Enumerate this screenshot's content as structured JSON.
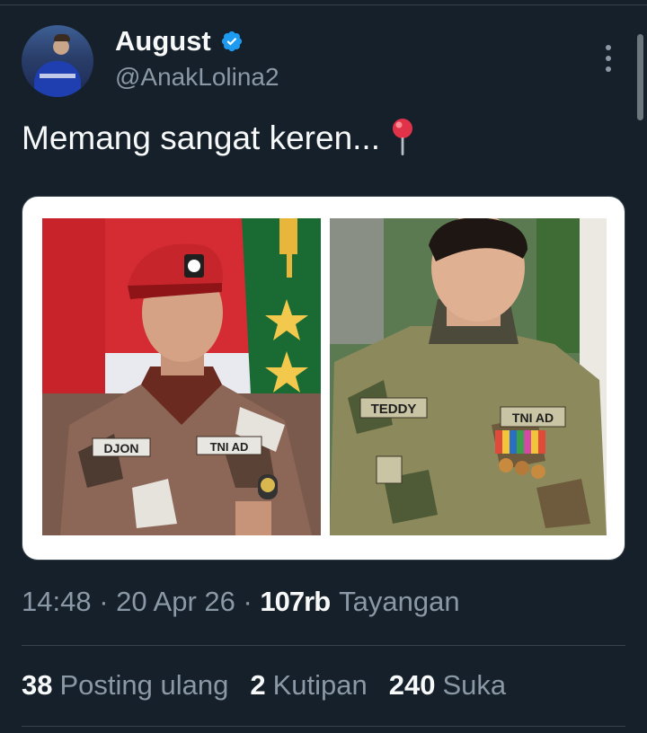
{
  "user": {
    "display_name": "August",
    "handle": "@AnakLolina2",
    "verified_icon": "verified-badge-icon"
  },
  "tweet": {
    "text": "Memang sangat keren...",
    "emoji_icon": "round-pushpin-icon"
  },
  "media": {
    "left_photo": {
      "badge_name": "DJON",
      "badge_unit": "TNI AD"
    },
    "right_photo": {
      "badge_name": "TEDDY",
      "badge_unit": "TNI AD"
    }
  },
  "meta": {
    "time": "14:48",
    "separator1": " · ",
    "date": "20 Apr 26",
    "separator2": " · ",
    "views": "107rb",
    "views_label": "Tayangan"
  },
  "stats": {
    "retweets": "38",
    "retweets_label": "Posting ulang",
    "quotes": "2",
    "quotes_label": "Kutipan",
    "likes": "240",
    "likes_label": "Suka"
  },
  "colors": {
    "background": "#15202b",
    "text_primary": "#f7f9f9",
    "text_secondary": "#8b98a5",
    "verified_blue": "#1d9bf0",
    "divider": "#38444d"
  }
}
